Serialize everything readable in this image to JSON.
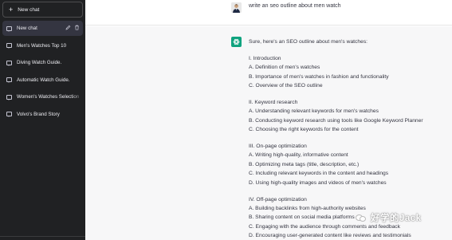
{
  "sidebar": {
    "new_chat_label": "New chat",
    "chats": [
      {
        "label": "New chat",
        "active": true
      },
      {
        "label": "Men's Watches Top 10",
        "active": false
      },
      {
        "label": "Diving Watch Guide.",
        "active": false
      },
      {
        "label": "Automatic Watch Guide.",
        "active": false
      },
      {
        "label": "Women's Watches Selection",
        "active": false
      },
      {
        "label": "Volvo's Brand Story",
        "active": false
      }
    ],
    "edit_icon": "pencil-icon",
    "delete_icon": "trash-icon"
  },
  "conversation": {
    "user_message": "write an seo outline about men watch",
    "assistant_lines": [
      "Sure, here's an SEO outline about men's watches:",
      "",
      "I. Introduction",
      "A. Definition of men's watches",
      "B. Importance of men's watches in fashion and functionality",
      "C. Overview of the SEO outline",
      "",
      "II. Keyword research",
      "A. Understanding relevant keywords for men's watches",
      "B. Conducting keyword research using tools like Google Keyword Planner",
      "C. Choosing the right keywords for the content",
      "",
      "III. On-page optimization",
      "A. Writing high-quality, informative content",
      "B. Optimizing meta tags (title, description, etc.)",
      "C. Including relevant keywords in the content and headings",
      "D. Using high-quality images and videos of men's watches",
      "",
      "IV. Off-page optimization",
      "A. Building backlinks from high-authority websites",
      "B. Sharing content on social media platforms",
      "C. Engaging with the audience through comments and feedback",
      "D. Encouraging user-generated content like reviews and testimonials"
    ]
  },
  "watermark": {
    "text": "好学的Jack",
    "icon": "wechat-icon"
  },
  "colors": {
    "sidebar_bg": "#202123",
    "active_item_bg": "#343541",
    "assistant_bg": "#f7f7f8",
    "gpt_green": "#10a37f"
  }
}
